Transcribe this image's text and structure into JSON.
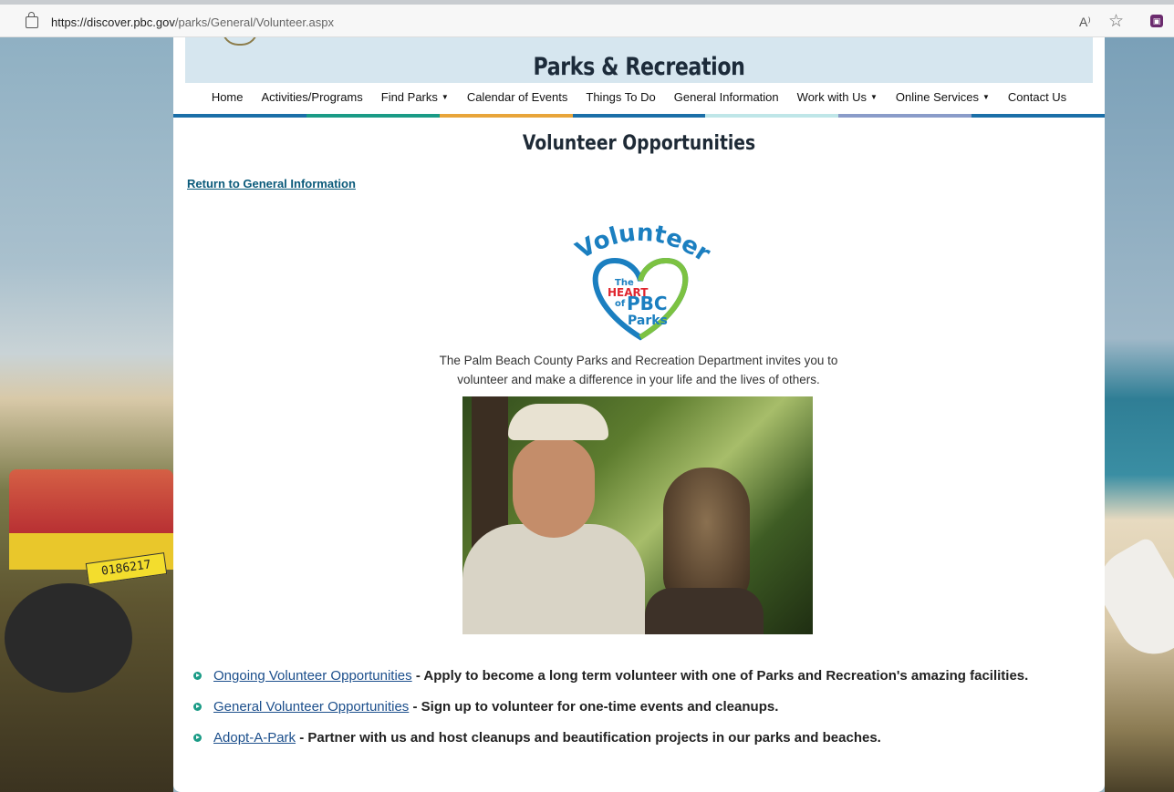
{
  "browser": {
    "url_domain": "https://discover.pbc.gov",
    "url_path": "/parks/General/Volunteer.aspx",
    "readaloud_label": "A⁾",
    "favorite_icon": "star-icon",
    "extension_icon": "extension-icon"
  },
  "header": {
    "title": "Parks & Recreation"
  },
  "nav": {
    "items": [
      {
        "label": "Home",
        "dropdown": false
      },
      {
        "label": "Activities/Programs",
        "dropdown": false
      },
      {
        "label": "Find Parks",
        "dropdown": true
      },
      {
        "label": "Calendar of Events",
        "dropdown": false
      },
      {
        "label": "Things To Do",
        "dropdown": false
      },
      {
        "label": "General Information",
        "dropdown": false
      },
      {
        "label": "Work with Us",
        "dropdown": true
      },
      {
        "label": "Online Services",
        "dropdown": true
      },
      {
        "label": "Contact Us",
        "dropdown": false
      }
    ],
    "bar_colors": [
      "#1b6fa8",
      "#1a9b86",
      "#e8a53a",
      "#1b6fa8",
      "#bfe6e8",
      "#8a9cc9",
      "#1b6fa8"
    ]
  },
  "main": {
    "heading": "Volunteer Opportunities",
    "return_link": "Return to General Information",
    "logo": {
      "word": "Volunteers",
      "heart_line1": "The",
      "heart_line2": "HEART",
      "heart_line3": "of",
      "heart_line4": "PBC",
      "heart_line5": "Parks"
    },
    "intro_line1": "The Palm Beach County Parks and Recreation Department invites you to",
    "intro_line2": "volunteer and make a difference in your life and the lives of others.",
    "opportunities": [
      {
        "link": "Ongoing Volunteer Opportunities",
        "text": " - Apply to become a long term volunteer with one of Parks and Recreation's amazing facilities."
      },
      {
        "link": "General Volunteer Opportunities",
        "text": " - Sign up to volunteer for one-time events and cleanups."
      },
      {
        "link": "Adopt-A-Park",
        "text": " - Partner with us and host cleanups and beautification projects in our parks and beaches."
      }
    ]
  },
  "background": {
    "plate_text": "0186217"
  }
}
